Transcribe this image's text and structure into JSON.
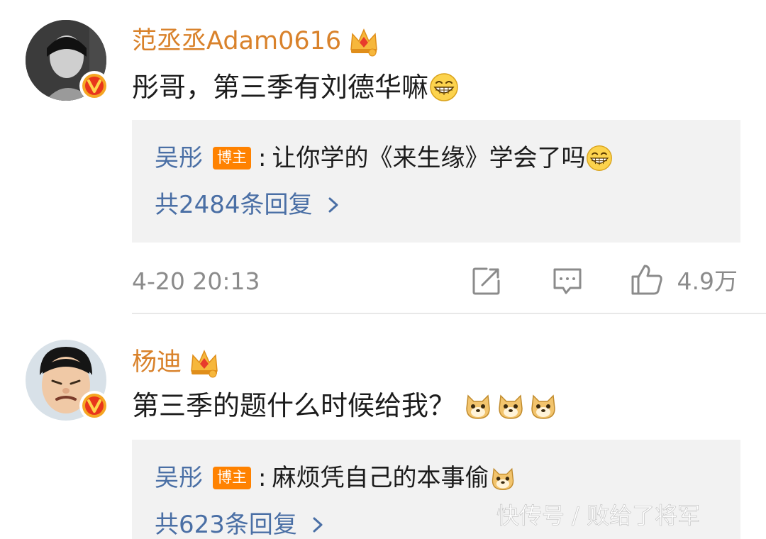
{
  "comments": [
    {
      "username": "范丞丞Adam0616",
      "text": "彤哥，第三季有刘德华嘛",
      "text_emojis": [
        "grin"
      ],
      "reply": {
        "name": "吴彤",
        "badge": "博主",
        "colon": ":",
        "text": "让你学的《来生缘》学会了吗",
        "text_emojis": [
          "grin"
        ]
      },
      "more_replies": "共2484条回复",
      "time": "4-20 20:13",
      "likes": "4.9万"
    },
    {
      "username": "杨迪",
      "text": "第三季的题什么时候给我？",
      "text_emojis": [
        "doge",
        "doge",
        "doge"
      ],
      "reply": {
        "name": "吴彤",
        "badge": "博主",
        "colon": ":",
        "text": "麻烦凭自己的本事偷",
        "text_emojis": [
          "doge"
        ]
      },
      "more_replies": "共623条回复"
    }
  ],
  "icons": [
    "crown-icon",
    "verified-v-icon",
    "share-icon",
    "comment-icon",
    "like-icon",
    "chevron-right-icon"
  ],
  "colors": {
    "username": "#d9822b",
    "reply_name": "#4a6fa5",
    "badge_bg": "#ff8200",
    "reply_bg": "#f2f2f2",
    "meta_gray": "#8b8b8b"
  },
  "watermark": "快传号 / 败给了将军"
}
